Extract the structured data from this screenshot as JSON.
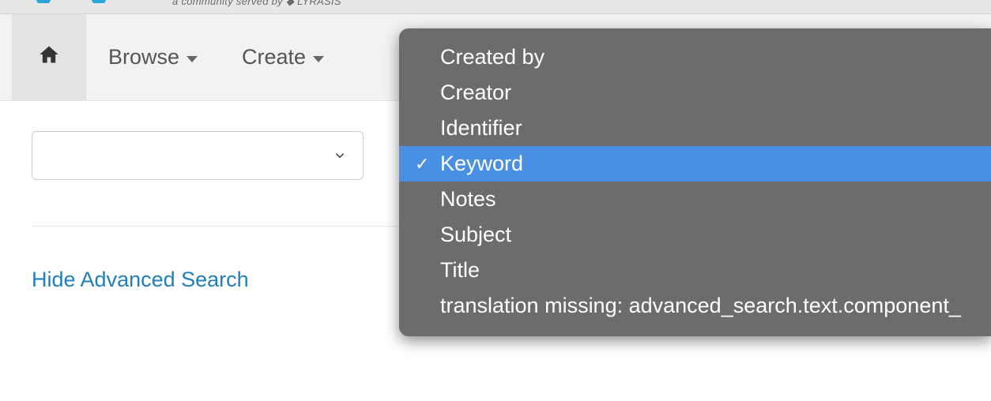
{
  "header": {
    "tagline": "a community served by ◆ LYRASIS"
  },
  "nav": {
    "browse_label": "Browse",
    "create_label": "Create"
  },
  "search": {
    "select_value": "",
    "hide_link": "Hide Advanced Search"
  },
  "options": [
    {
      "label": "Created by",
      "selected": false
    },
    {
      "label": "Creator",
      "selected": false
    },
    {
      "label": "Identifier",
      "selected": false
    },
    {
      "label": "Keyword",
      "selected": true
    },
    {
      "label": "Notes",
      "selected": false
    },
    {
      "label": "Subject",
      "selected": false
    },
    {
      "label": "Title",
      "selected": false
    },
    {
      "label": "translation missing: advanced_search.text.component_",
      "selected": false
    }
  ]
}
